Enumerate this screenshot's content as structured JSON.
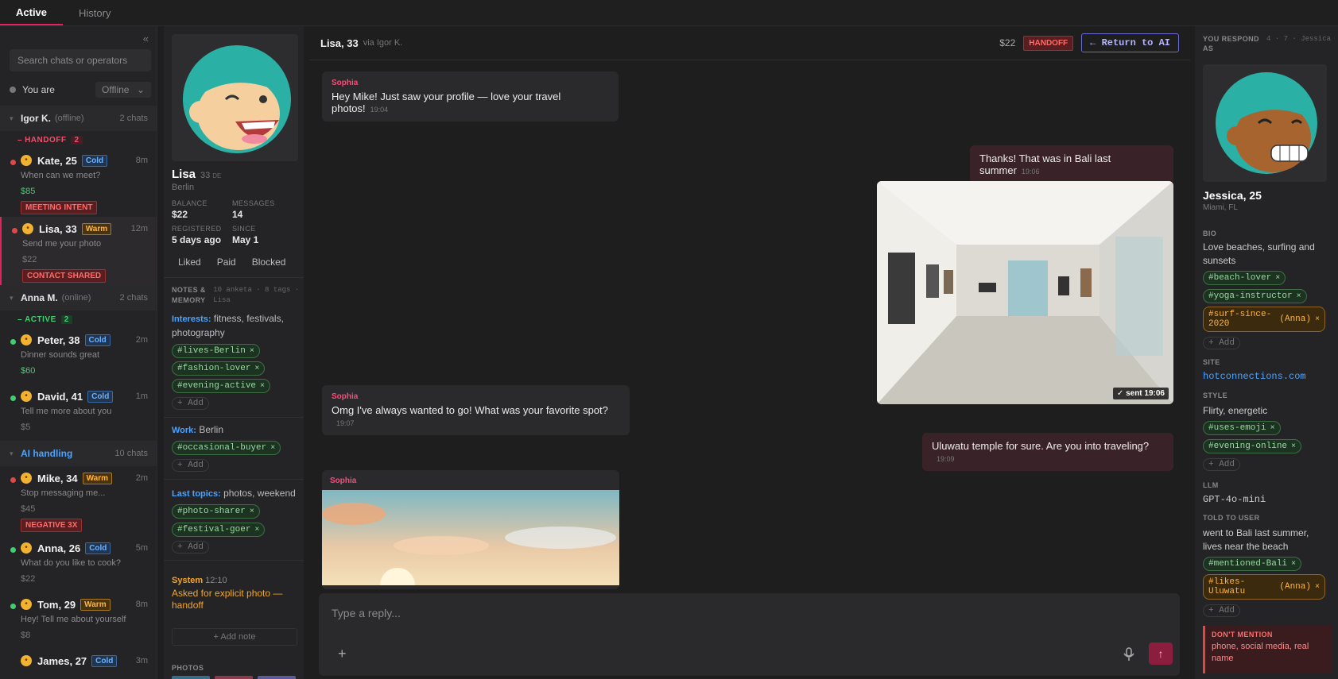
{
  "tabs": [
    "Active",
    "History"
  ],
  "sidebar": {
    "search_placeholder": "Search chats or operators",
    "you_are_label": "You are",
    "status_value": "Offline",
    "groups": [
      {
        "name": "Igor K.",
        "state": "(offline)",
        "count": "2 chats"
      },
      {
        "name": "Anna M.",
        "state": "(online)",
        "count": "2 chats"
      },
      {
        "name": "AI handling",
        "state": "",
        "count": "10 chats"
      }
    ],
    "sub_handoff": "HANDOFF",
    "sub_handoff_n": "2",
    "sub_active": "ACTIVE",
    "sub_active_n": "2",
    "chats": [
      {
        "name": "Kate, 25",
        "tag": "Cold",
        "time": "8m",
        "msg": "When can we meet?",
        "amount": "$85",
        "flag": "MEETING INTENT"
      },
      {
        "name": "Lisa, 33",
        "tag": "Warm",
        "time": "12m",
        "msg": "Send me your photo",
        "amount": "$22",
        "flag": "CONTACT SHARED"
      },
      {
        "name": "Peter, 38",
        "tag": "Cold",
        "time": "2m",
        "msg": "Dinner sounds great",
        "amount": "$60"
      },
      {
        "name": "David, 41",
        "tag": "Cold",
        "time": "1m",
        "msg": "Tell me more about you",
        "amount": "$5"
      },
      {
        "name": "Mike, 34",
        "tag": "Warm",
        "time": "2m",
        "msg": "Stop messaging me...",
        "amount": "$45",
        "flag": "NEGATIVE 3X"
      },
      {
        "name": "Anna, 26",
        "tag": "Cold",
        "time": "5m",
        "msg": "What do you like to cook?",
        "amount": "$22"
      },
      {
        "name": "Tom, 29",
        "tag": "Warm",
        "time": "8m",
        "msg": "Hey! Tell me about yourself",
        "amount": "$8"
      },
      {
        "name": "James, 27",
        "tag": "Cold",
        "time": "3m"
      }
    ]
  },
  "profile": {
    "name": "Lisa",
    "age": "33",
    "country": "DE",
    "city": "Berlin",
    "balance_k": "BALANCE",
    "balance_v": "$22",
    "messages_k": "MESSAGES",
    "messages_v": "14",
    "registered_k": "REGISTERED",
    "registered_v": "5 days ago",
    "since_k": "SINCE",
    "since_v": "May 1",
    "tabs": [
      "Liked",
      "Paid",
      "Blocked"
    ],
    "notes_k": "NOTES & MEMORY",
    "notes_meta": "10 anketa · 8 tags · Lisa",
    "interests_k": "Interests:",
    "interests_v": "fitness, festivals, photography",
    "chips1": [
      "#lives-Berlin",
      "#fashion-lover",
      "#evening-active"
    ],
    "work_k": "Work:",
    "work_v": "Berlin",
    "chips2": [
      "#occasional-buyer"
    ],
    "topics_k": "Last topics:",
    "topics_v": "photos, weekend",
    "chips3": [
      "#photo-sharer",
      "#festival-goer"
    ],
    "add": "+ Add",
    "system_k": "System",
    "system_time": "12:10",
    "system_text": "Asked for explicit photo — handoff",
    "add_note": "+ Add note",
    "photos_k": "PHOTOS"
  },
  "chat": {
    "title": "Lisa, 33",
    "via": "via Igor K.",
    "balance": "$22",
    "handoff": "HANDOFF",
    "return": "← Return to AI",
    "messages": [
      {
        "who": "Sophia",
        "text": "Hey Mike! Just saw your profile — love your travel photos!",
        "time": "19:04"
      },
      {
        "text": "Thanks! That was in Bali last summer",
        "time": "19:06"
      },
      {
        "sent": "✓ sent 19:06"
      },
      {
        "who": "Sophia",
        "text": "Omg I've always wanted to go! What was your favorite spot?",
        "time": "19:07"
      },
      {
        "text": "Uluwatu temple for sure. Are you into traveling?",
        "time": "19:09"
      },
      {
        "who": "Sophia"
      }
    ],
    "composer_placeholder": "Type a reply..."
  },
  "persona": {
    "respond_k": "YOU RESPOND AS",
    "respond_meta": "4 · 7 · Jessica",
    "name": "Jessica, 25",
    "city": "Miami, FL",
    "bio_k": "BIO",
    "bio_v": "Love beaches, surfing and sunsets",
    "bio_chips": [
      "#beach-lover",
      "#yoga-instructor"
    ],
    "bio_chip_orange": "#surf-since-2020",
    "anna": "(Anna)",
    "site_k": "SITE",
    "site_v": "hotconnections.com",
    "style_k": "STYLE",
    "style_v": "Flirty, energetic",
    "style_chips": [
      "#uses-emoji",
      "#evening-online"
    ],
    "llm_k": "LLM",
    "llm_v": "GPT-4o-mini",
    "told_k": "TOLD TO USER",
    "told_v": "went to Bali last summer, lives near the beach",
    "told_chip": "#mentioned-Bali",
    "told_chip_orange": "#likes-Uluwatu",
    "add": "+ Add",
    "dont_k": "DON'T MENTION",
    "dont_v": "phone, social media, real name"
  },
  "colors": {
    "accent": "#e0245e",
    "online": "#3fcf6f",
    "handoff": "#ff6b6b",
    "link": "#4aa3ff"
  }
}
